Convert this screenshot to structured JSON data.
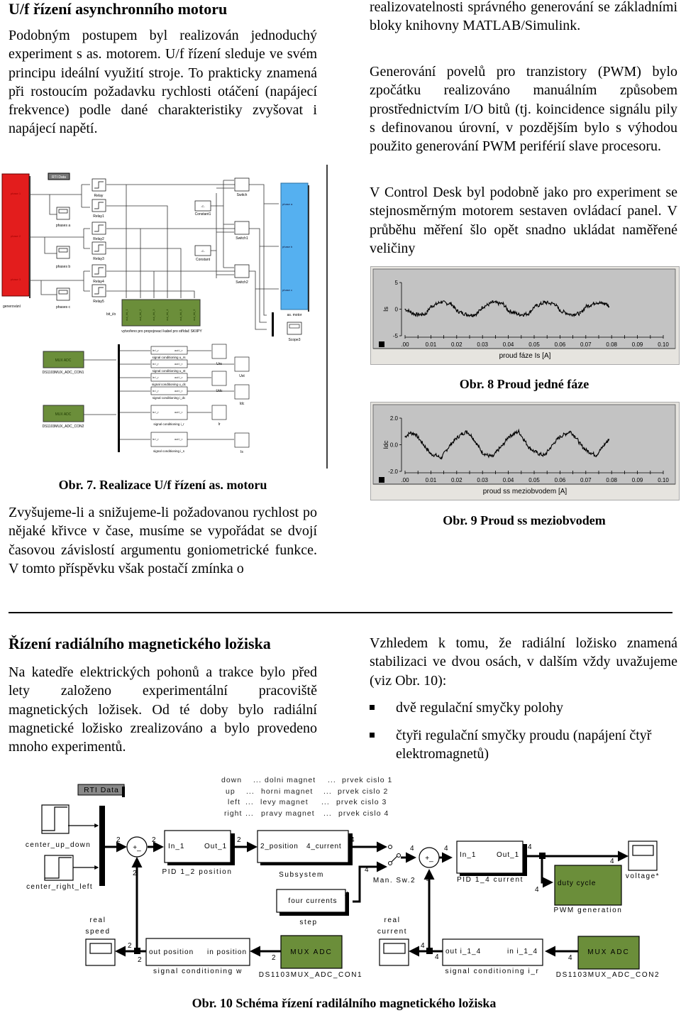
{
  "section1": {
    "heading": "U/f řízení asynchronního motoru",
    "paragraph_left": "Podobným postupem byl realizován jednoduchý experiment s as. motorem. U/f řízení sleduje ve svém principu ideální využití stroje. To prakticky znamená při rostoucím požadavku rychlosti otáčení (napájecí frekvence) podle dané charakteristiky zvyšovat i napájecí napětí.",
    "paragraph_right_1": "realizovatelnosti správného generování se základními bloky knihovny MATLAB/Simulink.",
    "paragraph_right_2": "Generování povelů pro tranzistory (PWM) bylo zpočátku realizováno manuálním způsobem prostřednictvím I/O bitů (tj. koincidence signálu pily s definovanou úrovní, v pozdějším bylo s výhodou použito generování PWM periférií slave procesoru.",
    "paragraph_right_3": "V Control Desk byl podobně jako pro experiment se stejnosměrným motorem sestaven ovládací panel. V průběhu měření šlo opět snadno ukládat naměřené veličiny",
    "paragraph_left_2": "Zvyšujeme-li a snižujeme-li požadovanou rychlost po nějaké křivce v čase, musíme se vypořádat se dvojí časovou závislostí argumentu goniometrické funkce. V tomto příspěvku však postačí zmínka o"
  },
  "figure7": {
    "caption": "Obr. 7. Realizace U/f řízení as. motoru",
    "rti_data": "RTI Data",
    "generator_label": "generování",
    "generator_ports": [
      "phase 1",
      "phase 2",
      "phase 3"
    ],
    "scopes": [
      "phases a",
      "phases b",
      "phases c"
    ],
    "relays": [
      "Relay",
      "Relay1",
      "Relay2",
      "Relay3",
      "Relay4",
      "Relay5"
    ],
    "constants": [
      "Constant1",
      "Constant"
    ],
    "constant_value": "-C-",
    "switches": [
      "Switch",
      "Switch1",
      "Switch2"
    ],
    "motor_label": "as. motor",
    "motor_ports": [
      "phase a",
      "phase b",
      "phase c"
    ],
    "scope3": "Scope3",
    "bit_io_label": "bit_i/o",
    "bit_outputs": [
      "out_bit_1",
      "out_bit_2",
      "out_bit_3",
      "out_bit_4",
      "out_bit_5",
      "out_bit_6"
    ],
    "bit_io_caption": "vytvořeno pro propojovací kabel pro střídač SKIIPY",
    "mux1_label": "MUX ADC",
    "mux1_name": "DS1103MUX_ADC_CON1",
    "mux2_label": "MUX ADC",
    "mux2_name": "DS1103MUX_ADC_CON2",
    "cond_in": "in i_r",
    "cond_out": "out i_r",
    "conditioning": [
      {
        "name": "signal conditioning u_rs",
        "scope": "Urs"
      },
      {
        "name": "signal conditioning u_st",
        "scope": "Ust"
      },
      {
        "name": "signal conditioning u_dc",
        "scope": "Udc"
      },
      {
        "name": "signal conditioning i_dc",
        "scope": "Idc"
      },
      {
        "name": "signal conditioning i_r",
        "scope": "Ir"
      },
      {
        "name": "signal conditioning i_s",
        "scope": "Is"
      }
    ]
  },
  "figure8": {
    "caption": "Obr. 8 Proud jedné fáze",
    "chart_data": {
      "type": "line",
      "title": "proud fáze Is [A]",
      "ylabel": "Is",
      "xlabel": "",
      "ylim": [
        -5,
        5
      ],
      "yticks": [
        "5",
        "0",
        "-5"
      ],
      "xlim": [
        0,
        0.1
      ],
      "xticks": [
        ".00",
        "0.01",
        "0.02",
        "0.03",
        "0.04",
        "0.05",
        "0.06",
        "0.07",
        "0.08",
        "0.09",
        "0.10"
      ],
      "series": [
        {
          "name": "Is",
          "x": [
            0.0,
            0.002,
            0.004,
            0.006,
            0.008,
            0.01,
            0.012,
            0.014,
            0.016,
            0.018,
            0.02,
            0.022,
            0.024,
            0.026,
            0.028,
            0.03,
            0.032,
            0.034,
            0.036,
            0.038,
            0.04,
            0.042,
            0.044,
            0.046,
            0.048,
            0.05,
            0.052,
            0.054,
            0.056,
            0.058,
            0.06,
            0.062,
            0.064,
            0.066,
            0.068,
            0.07,
            0.072,
            0.074,
            0.076,
            0.078,
            0.079
          ],
          "y": [
            0.0,
            -0.5,
            -1.0,
            -1.0,
            -0.9,
            0.5,
            0.9,
            1.4,
            1.1,
            1.0,
            -0.3,
            -0.7,
            -1.0,
            -1.1,
            -0.8,
            0.4,
            0.8,
            1.3,
            1.1,
            1.0,
            -0.3,
            -0.6,
            -1.0,
            -1.0,
            -0.8,
            0.4,
            0.8,
            1.3,
            1.1,
            1.0,
            -0.3,
            -0.6,
            -1.0,
            -0.9,
            -0.8,
            0.5,
            0.8,
            1.3,
            1.1,
            1.0,
            0.4
          ]
        }
      ]
    }
  },
  "figure9": {
    "caption": "Obr. 9 Proud ss meziobvodem",
    "chart_data": {
      "type": "line",
      "title": "proud ss meziobvodem [A]",
      "ylabel": "Idc",
      "xlabel": "",
      "ylim": [
        -2.0,
        2.0
      ],
      "yticks": [
        "2.0",
        "0.0",
        "-2.0"
      ],
      "xlim": [
        0,
        0.1
      ],
      "xticks": [
        ".00",
        "0.01",
        "0.02",
        "0.03",
        "0.04",
        "0.05",
        "0.06",
        "0.07",
        "0.08",
        "0.09",
        "0.10"
      ],
      "series": [
        {
          "name": "Idc",
          "x": [
            0.0,
            0.002,
            0.004,
            0.006,
            0.008,
            0.01,
            0.012,
            0.014,
            0.016,
            0.018,
            0.02,
            0.022,
            0.024,
            0.026,
            0.028,
            0.03,
            0.032,
            0.034,
            0.036,
            0.038,
            0.04,
            0.042,
            0.044,
            0.046,
            0.048,
            0.05,
            0.052,
            0.054,
            0.056,
            0.058,
            0.06,
            0.062,
            0.064,
            0.066,
            0.068,
            0.07,
            0.072,
            0.074,
            0.076,
            0.078,
            0.079
          ],
          "y": [
            0.6,
            0.9,
            0.8,
            0.3,
            -0.2,
            -0.7,
            -0.8,
            -1.0,
            -0.4,
            0.1,
            0.5,
            0.8,
            1.0,
            0.6,
            0.0,
            -0.6,
            -0.8,
            -0.9,
            -0.4,
            0.0,
            0.6,
            0.8,
            1.0,
            0.4,
            -0.2,
            -0.5,
            -0.7,
            -0.8,
            -0.3,
            0.2,
            0.6,
            0.8,
            1.0,
            0.6,
            0.0,
            -0.4,
            -0.6,
            -0.8,
            -0.3,
            0.2,
            0.4
          ]
        }
      ]
    }
  },
  "section2": {
    "heading": "Řízení radiálního magnetického ložiska",
    "paragraph_left": "Na katedře elektrických pohonů a trakce bylo před lety založeno experimentální pracoviště magnetických ložisek. Od té doby bylo radiální magnetické ložisko zrealizováno a bylo provedeno mnoho experimentů.",
    "paragraph_right": "Vzhledem k tomu, že radiální ložisko znamená stabilizaci ve dvou osách, v dalším vždy uvažujeme (viz Obr. 10):",
    "bullets": [
      "dvě regulační smyčky polohy",
      "čtyři regulační smyčky proudu (napájení čtyř elektromagnetů)"
    ]
  },
  "figure10": {
    "caption": "Obr. 10 Schéma řízení radilálního magnetického ložiska",
    "rti_data": "RTI Data",
    "legend": [
      [
        "down",
        "...",
        "dolni magnet",
        "...",
        "prvek cislo 1"
      ],
      [
        "up",
        "...",
        "horni magnet",
        "...",
        "prvek cislo 2"
      ],
      [
        "left",
        "...",
        "levy magnet",
        "...",
        "prvek cislo 3"
      ],
      [
        "right",
        "...",
        "pravy magnet",
        "...",
        "prvek cislo 4"
      ]
    ],
    "step_blocks": [
      "center_up_down",
      "center_right_left"
    ],
    "sum_sign": "+_",
    "pid_pos": {
      "in": "In_1",
      "out": "Out_1",
      "name": "PID 1_2 position"
    },
    "subsystem": {
      "in": "2_position",
      "out": "4_current",
      "name": "Subsystem"
    },
    "step": {
      "out": "four currents",
      "name": "step"
    },
    "manual_switch": "Man. Sw.2",
    "pid_cur": {
      "in": "In_1",
      "out": "Out_1",
      "name": "PID 1_4 current"
    },
    "pwm": {
      "in": "duty cycle",
      "name": "PWM generation"
    },
    "voltage_scope": "voltage*",
    "speed_scope": "real speed",
    "current_scope": "real current",
    "cond_w": {
      "out": "out position",
      "in": "in position",
      "name": "signal conditioning w"
    },
    "cond_i": {
      "out": "out i_1_4",
      "in": "in i_1_4",
      "name": "signal conditioning i_r"
    },
    "mux1": {
      "label": "MUX ADC",
      "name": "DS1103MUX_ADC_CON1"
    },
    "mux2": {
      "label": "MUX ADC",
      "name": "DS1103MUX_ADC_CON2"
    },
    "width2": "2",
    "width4": "4"
  }
}
